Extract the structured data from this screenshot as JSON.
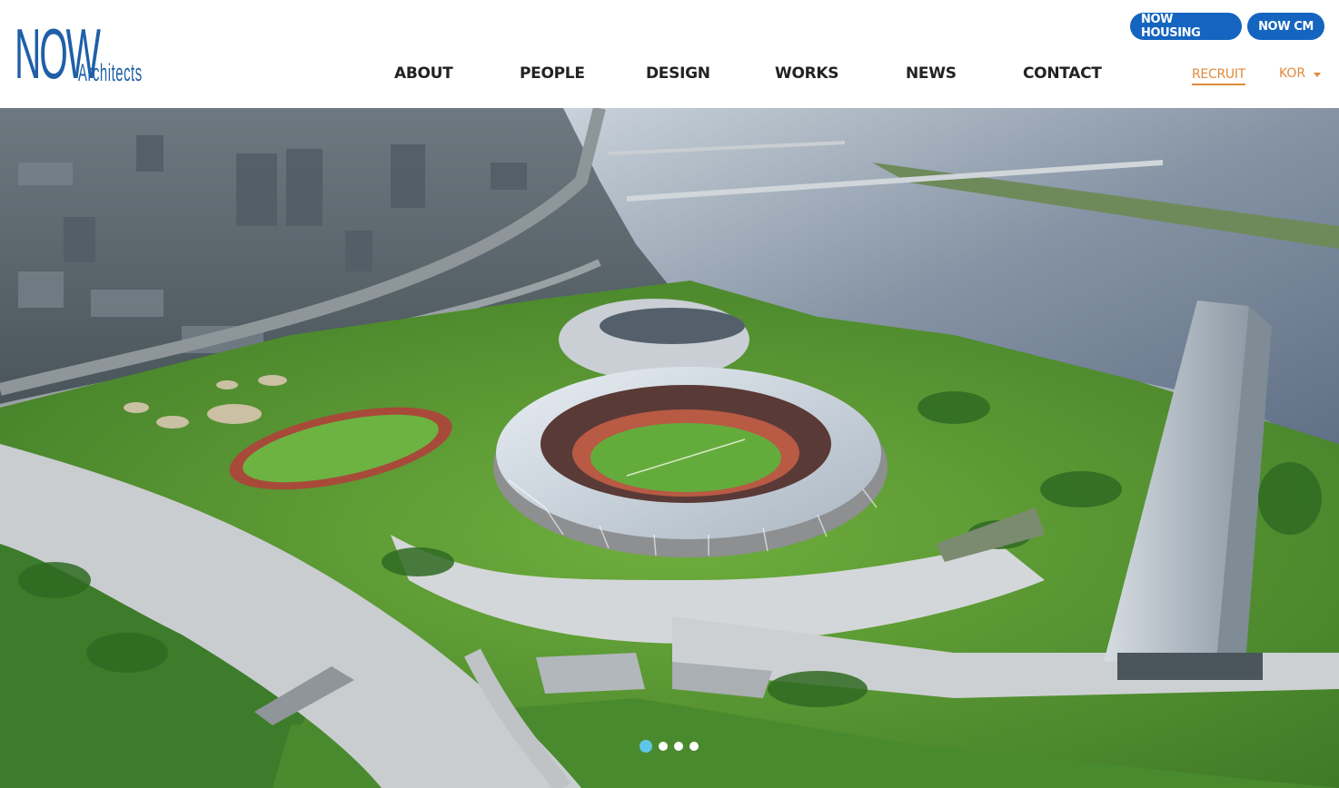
{
  "logo": {
    "main": "NOW",
    "sub": "Architects"
  },
  "top_buttons": {
    "housing": "NOW HOUSING",
    "cm": "NOW CM"
  },
  "nav": {
    "items": [
      {
        "label": "ABOUT"
      },
      {
        "label": "PEOPLE"
      },
      {
        "label": "DESIGN"
      },
      {
        "label": "WORKS"
      },
      {
        "label": "NEWS"
      },
      {
        "label": "CONTACT"
      }
    ],
    "recruit": "RECRUIT",
    "language": "KOR"
  },
  "hero": {
    "description": "",
    "slide_count": 4,
    "active_slide": 1
  },
  "colors": {
    "brand_blue": "#1565c0",
    "logo_blue": "#1f5fa8",
    "accent_orange": "#e08a3c",
    "active_dot": "#5fc6e8"
  }
}
